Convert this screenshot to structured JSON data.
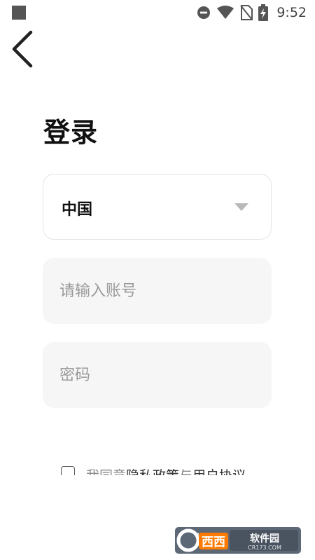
{
  "status_bar": {
    "time": "9:52",
    "icons": [
      "notification-square-icon",
      "do-not-disturb-icon",
      "wifi-icon",
      "no-sim-icon",
      "battery-charging-icon"
    ]
  },
  "header": {
    "back_icon": "chevron-left-icon"
  },
  "login": {
    "title": "登录",
    "country": {
      "value": "中国",
      "arrow_icon": "dropdown-arrow-icon"
    },
    "account": {
      "placeholder": "请输入账号",
      "value": ""
    },
    "password": {
      "placeholder": "密码",
      "value": ""
    },
    "agreement": {
      "prefix": "我同意",
      "privacy_link": "隐私政策",
      "conjunction": "与",
      "terms_link": "用户协议"
    }
  },
  "watermark": {
    "brand": "西西",
    "tagline": "软件园",
    "site": "CR173.COM"
  },
  "colors": {
    "background": "#ffffff",
    "title_text": "#111111",
    "input_fill": "#f6f6f6",
    "select_border": "#e4e4e4",
    "placeholder": "#9a9a9a",
    "arrow": "#b9b9b9",
    "watermark_orange": "#ff7a00"
  }
}
